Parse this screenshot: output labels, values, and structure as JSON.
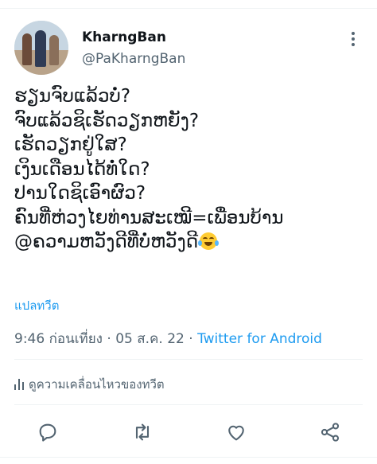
{
  "user": {
    "display_name": "KharngBan",
    "handle": "@PaKharngBan"
  },
  "tweet": {
    "lines": [
      "ຮຽນຈົບແລ້ວບໍ່?",
      "ຈົບແລ້ວຊິເຮັດວຽກຫຍັງ?",
      "ເຮັດວຽກຢູ່ໃສ?",
      "ເງິນເດືອນໄດ້ທໍ່ໃດ?",
      "ປານໃດຊິເອົາຜົວ?",
      "ຄົນທີ່ຫ່ວງໄຍທ່ານສະເໝີ=ເພື່ອນບ້ານ",
      "@ຄວາມຫວັງດີທີ່ບໍ່ຫວັງດີ"
    ],
    "emoji_icon": "tears-of-joy-emoji",
    "translate_label": "แปลทวีต"
  },
  "meta": {
    "time": "9:46 ก่อนเที่ยง",
    "separator": "·",
    "date": "05 ส.ค. 22",
    "source": "Twitter for Android"
  },
  "activity": {
    "label": "ดูความเคลื่อนไหวของทวีต",
    "icon": "analytics-icon"
  },
  "actions": [
    {
      "name": "reply-icon"
    },
    {
      "name": "retweet-icon"
    },
    {
      "name": "like-icon"
    },
    {
      "name": "share-icon"
    }
  ],
  "colors": {
    "link": "#1d9bf0",
    "secondary_text": "#536471",
    "primary_text": "#0f1419",
    "divider": "#eff3f4"
  }
}
